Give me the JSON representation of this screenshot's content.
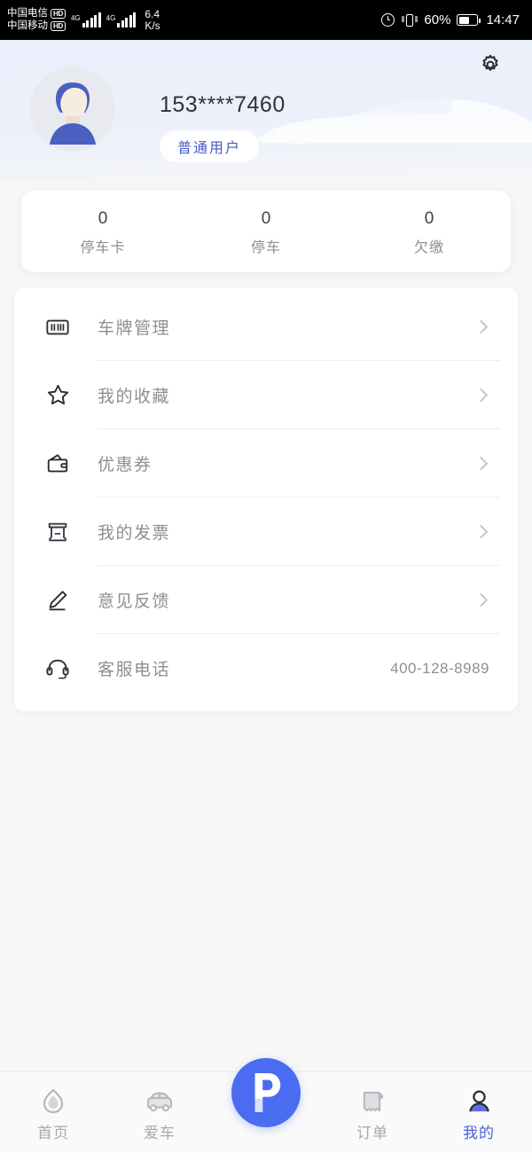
{
  "statusbar": {
    "carrier1": "中国电信",
    "carrier1_badge": "HD",
    "carrier2": "中国移动",
    "carrier2_badge": "HD",
    "network1": "4G",
    "network2": "4G",
    "netspeed_value": "6.4",
    "netspeed_unit": "K/s",
    "battery": "60%",
    "time": "14:47",
    "alarm_icon": "alarm-icon",
    "vibrate_icon": "vibrate-icon",
    "battery_icon": "battery-icon"
  },
  "header": {
    "phone": "153****7460",
    "badge": "普通用户",
    "gear_icon": "gear-icon",
    "avatar_icon": "avatar",
    "car_watermark": "car-silhouette"
  },
  "stats": [
    {
      "value": "0",
      "label": "停车卡"
    },
    {
      "value": "0",
      "label": "停车"
    },
    {
      "value": "0",
      "label": "欠缴"
    }
  ],
  "menu": [
    {
      "label": "车牌管理",
      "icon": "license-plate-icon",
      "value": "",
      "chevron": true
    },
    {
      "label": "我的收藏",
      "icon": "star-icon",
      "value": "",
      "chevron": true
    },
    {
      "label": "优惠券",
      "icon": "wallet-icon",
      "value": "",
      "chevron": true
    },
    {
      "label": "我的发票",
      "icon": "invoice-icon",
      "value": "",
      "chevron": true
    },
    {
      "label": "意见反馈",
      "icon": "pencil-icon",
      "value": "",
      "chevron": true
    },
    {
      "label": "客服电话",
      "icon": "headset-icon",
      "value": "400-128-8989",
      "chevron": false
    }
  ],
  "tabbar": {
    "items": [
      {
        "label": "首页",
        "icon": "home-icon",
        "active": false
      },
      {
        "label": "爱车",
        "icon": "car-icon",
        "active": false
      },
      {
        "label": "订单",
        "icon": "receipt-icon",
        "active": false
      },
      {
        "label": "我的",
        "icon": "person-icon",
        "active": true
      }
    ],
    "fab": {
      "label": "P",
      "icon": "parking-p-icon"
    }
  },
  "colors": {
    "accent": "#4a6cf0",
    "active_tab": "#4a63d6",
    "badge_text": "#4559c4",
    "header_bg": "#eaeffb",
    "page_bg": "#f7f7f8",
    "card_bg": "#ffffff",
    "muted_text": "#8d8f95"
  }
}
